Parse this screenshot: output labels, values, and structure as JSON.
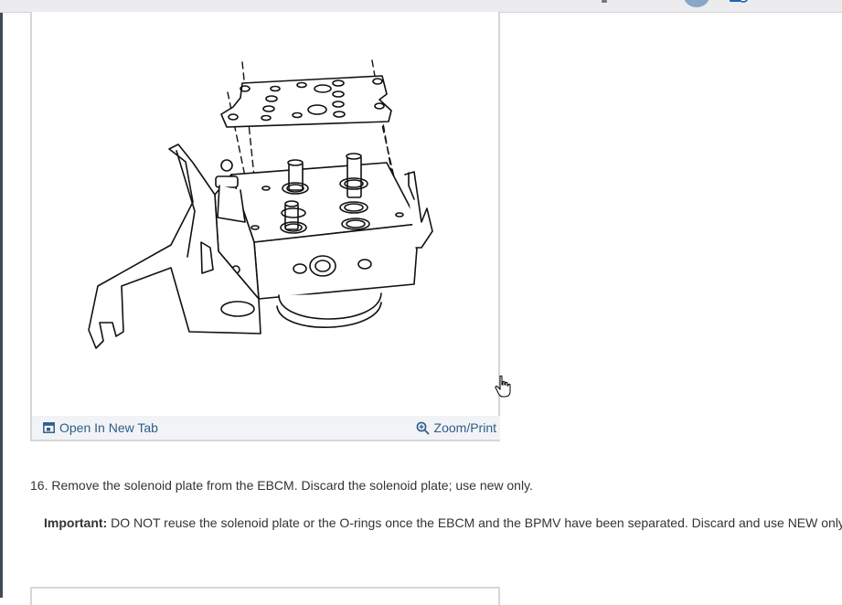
{
  "figure": {
    "open_tab_label": "Open In New Tab",
    "zoom_label": "Zoom/Print",
    "open_tab_icon": "open-in-new-tab-icon",
    "zoom_icon": "zoom-in-icon"
  },
  "step": {
    "text": "16. Remove the solenoid plate from the EBCM. Discard the solenoid plate; use new only."
  },
  "important": {
    "label": "Important:",
    "text": " DO NOT reuse the solenoid plate or the O-rings once the EBCM and the BPMV have been separated. Discard and use NEW only."
  },
  "colors": {
    "link": "#2f5d8a",
    "figure_bar": "#f2f3f6",
    "text": "#333333"
  }
}
